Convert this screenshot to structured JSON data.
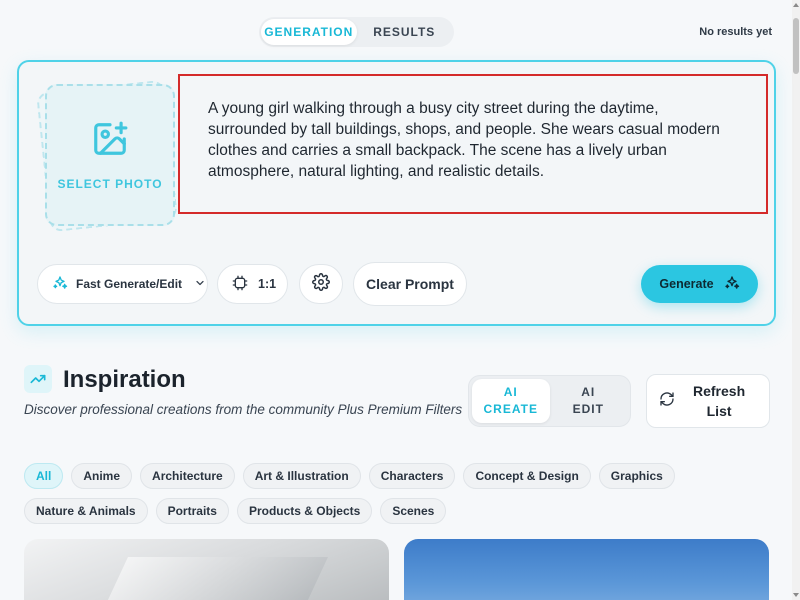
{
  "tabs": [
    {
      "label": "GENERATION",
      "active": true
    },
    {
      "label": "RESULTS",
      "active": false
    }
  ],
  "status": {
    "no_results": "No results yet"
  },
  "generator": {
    "select_photo_label": "SELECT PHOTO",
    "prompt_text": "A young girl walking through a busy city street during the daytime, surrounded by tall buildings, shops, and people. She wears casual modern clothes and carries a small backpack. The scene has a lively urban atmosphere, natural lighting, and realistic details.",
    "mode_label": "Fast Generate/Edit",
    "ratio_label": "1:1",
    "clear_label": "Clear Prompt",
    "generate_label": "Generate"
  },
  "inspiration": {
    "title": "Inspiration",
    "subtitle": "Discover professional creations from the community Plus Premium Filters",
    "toggle": [
      {
        "line1": "AI",
        "line2": "CREATE",
        "active": true
      },
      {
        "line1": "AI",
        "line2": "EDIT",
        "active": false
      }
    ],
    "refresh_line1": "Refresh",
    "refresh_line2": "List",
    "categories": [
      "All",
      "Anime",
      "Architecture",
      "Art & Illustration",
      "Characters",
      "Concept & Design",
      "Graphics",
      "Nature & Animals",
      "Portraits",
      "Products & Objects",
      "Scenes"
    ],
    "active_category": "All"
  },
  "colors": {
    "accent": "#2bc6e1",
    "accent_text": "#19b8d6",
    "highlight_border": "#d42a2a"
  }
}
